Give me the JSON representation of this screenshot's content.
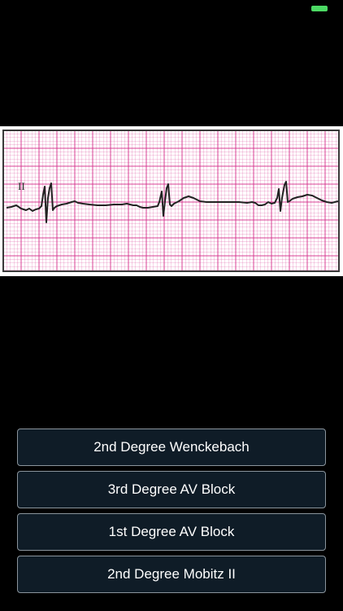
{
  "status_bar": {
    "battery_icon": "battery-icon",
    "battery_color": "#4cd964"
  },
  "ecg": {
    "lead_label": "II",
    "grid_color": "#d6368f",
    "trace_color": "#222222"
  },
  "answers": [
    {
      "label": "2nd Degree Wenckebach"
    },
    {
      "label": "3rd Degree AV Block"
    },
    {
      "label": "1st Degree AV Block"
    },
    {
      "label": "2nd Degree Mobitz II"
    }
  ],
  "theme": {
    "background": "#000000",
    "button_background": "#0f1c27",
    "button_border": "#8a949c",
    "button_text": "#ffffff"
  }
}
